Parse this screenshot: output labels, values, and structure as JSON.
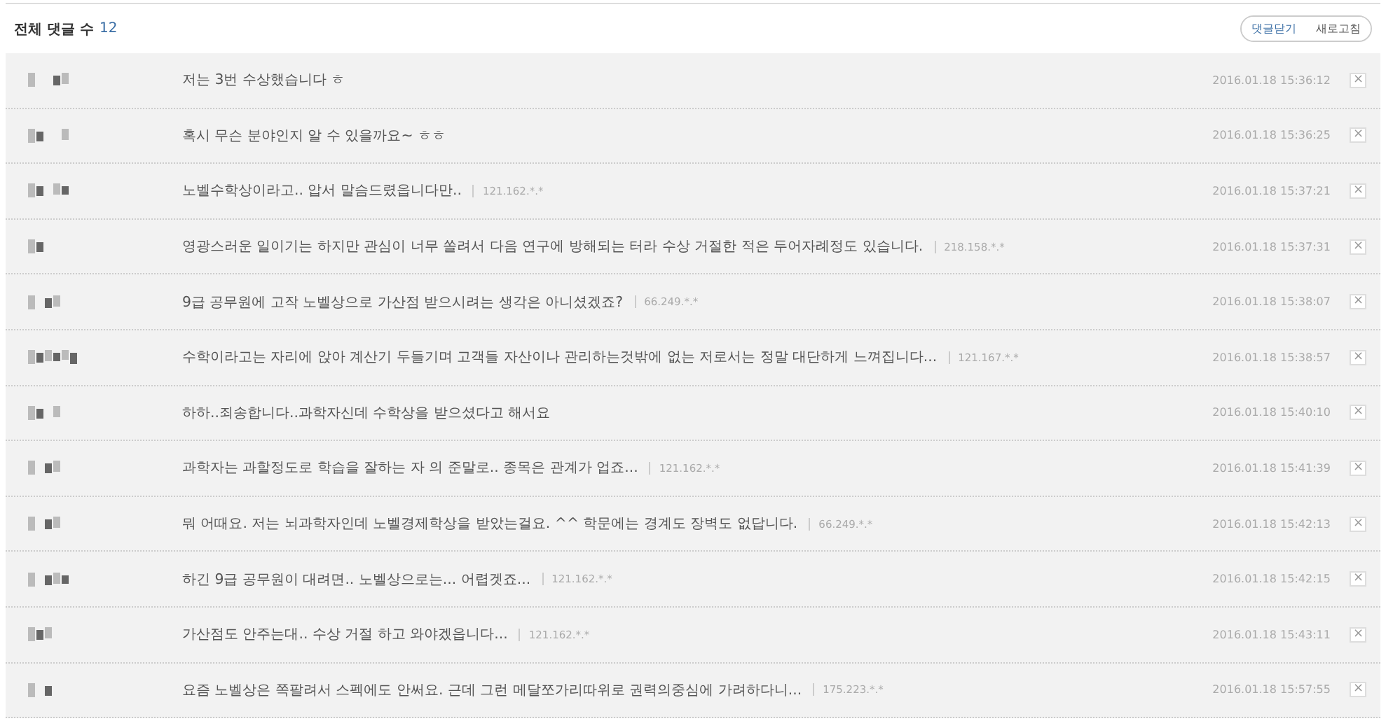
{
  "header": {
    "title": "전체 댓글 수",
    "count": "12",
    "buttons": [
      {
        "label": "댓글닫기",
        "kind": "primary"
      },
      {
        "label": "새로고침",
        "kind": "plain"
      }
    ]
  },
  "comments": [
    {
      "text": "저는 3번 수상했습니다 ㅎ",
      "time": "2016.01.18 15:36:12",
      "close": "×"
    },
    {
      "text": "혹시 무슨 분야인지 알 수 있을까요~ ㅎㅎ",
      "time": "2016.01.18 15:36:25",
      "close": "×"
    },
    {
      "text": "노벨수학상이라고.. 압서 말슴드렸읍니다만..",
      "ip": "121.162.*.*",
      "time": "2016.01.18 15:37:21",
      "close": "×"
    },
    {
      "text": "영광스러운 일이기는 하지만 관심이 너무 쏠려서 다음 연구에 방해되는 터라 수상 거절한 적은 두어자례정도 있습니다.",
      "ip": "218.158.*.*",
      "time": "2016.01.18 15:37:31",
      "close": "×"
    },
    {
      "text": "9급 공무원에 고작 노벨상으로 가산점 받으시려는 생각은 아니셨겠죠?",
      "ip": "66.249.*.*",
      "time": "2016.01.18 15:38:07",
      "close": "×"
    },
    {
      "text": "수학이라고는 자리에 앉아 계산기 두들기며 고객들 자산이나 관리하는것밖에 없는 저로서는 정말 대단하게 느껴집니다...",
      "ip": "121.167.*.*",
      "time": "2016.01.18 15:38:57",
      "close": "×"
    },
    {
      "text": "하하..죄송합니다..과학자신데 수학상을 받으셨다고 해서요",
      "time": "2016.01.18 15:40:10",
      "close": "×"
    },
    {
      "text": "과학자는 과할정도로 학습을 잘하는 자 의 준말로.. 종목은 관계가 업죠...",
      "ip": "121.162.*.*",
      "time": "2016.01.18 15:41:39",
      "close": "×"
    },
    {
      "text": "뭐 어때요. 저는 뇌과학자인데 노벨경제학상을 받았는걸요. ^^ 학문에는 경계도 장벽도 없답니다.",
      "ip": "66.249.*.*",
      "time": "2016.01.18 15:42:13",
      "close": "×"
    },
    {
      "text": "하긴 9급 공무원이 대려면.. 노벨상으로는... 어렵겟죠...",
      "ip": "121.162.*.*",
      "time": "2016.01.18 15:42:15",
      "close": "×"
    },
    {
      "text": "가산점도 안주는대.. 수상 거절 하고 와야겠읍니다...",
      "ip": "121.162.*.*",
      "time": "2016.01.18 15:43:11",
      "close": "×"
    },
    {
      "text": "요즘 노벨상은 쪽팔려서 스펙에도 안써요. 근데 그런 메달쪼가리따위로 권력의중심에 가려하다니...",
      "ip": "175.223.*.*",
      "time": "2016.01.18 15:57:55",
      "close": "×"
    }
  ]
}
